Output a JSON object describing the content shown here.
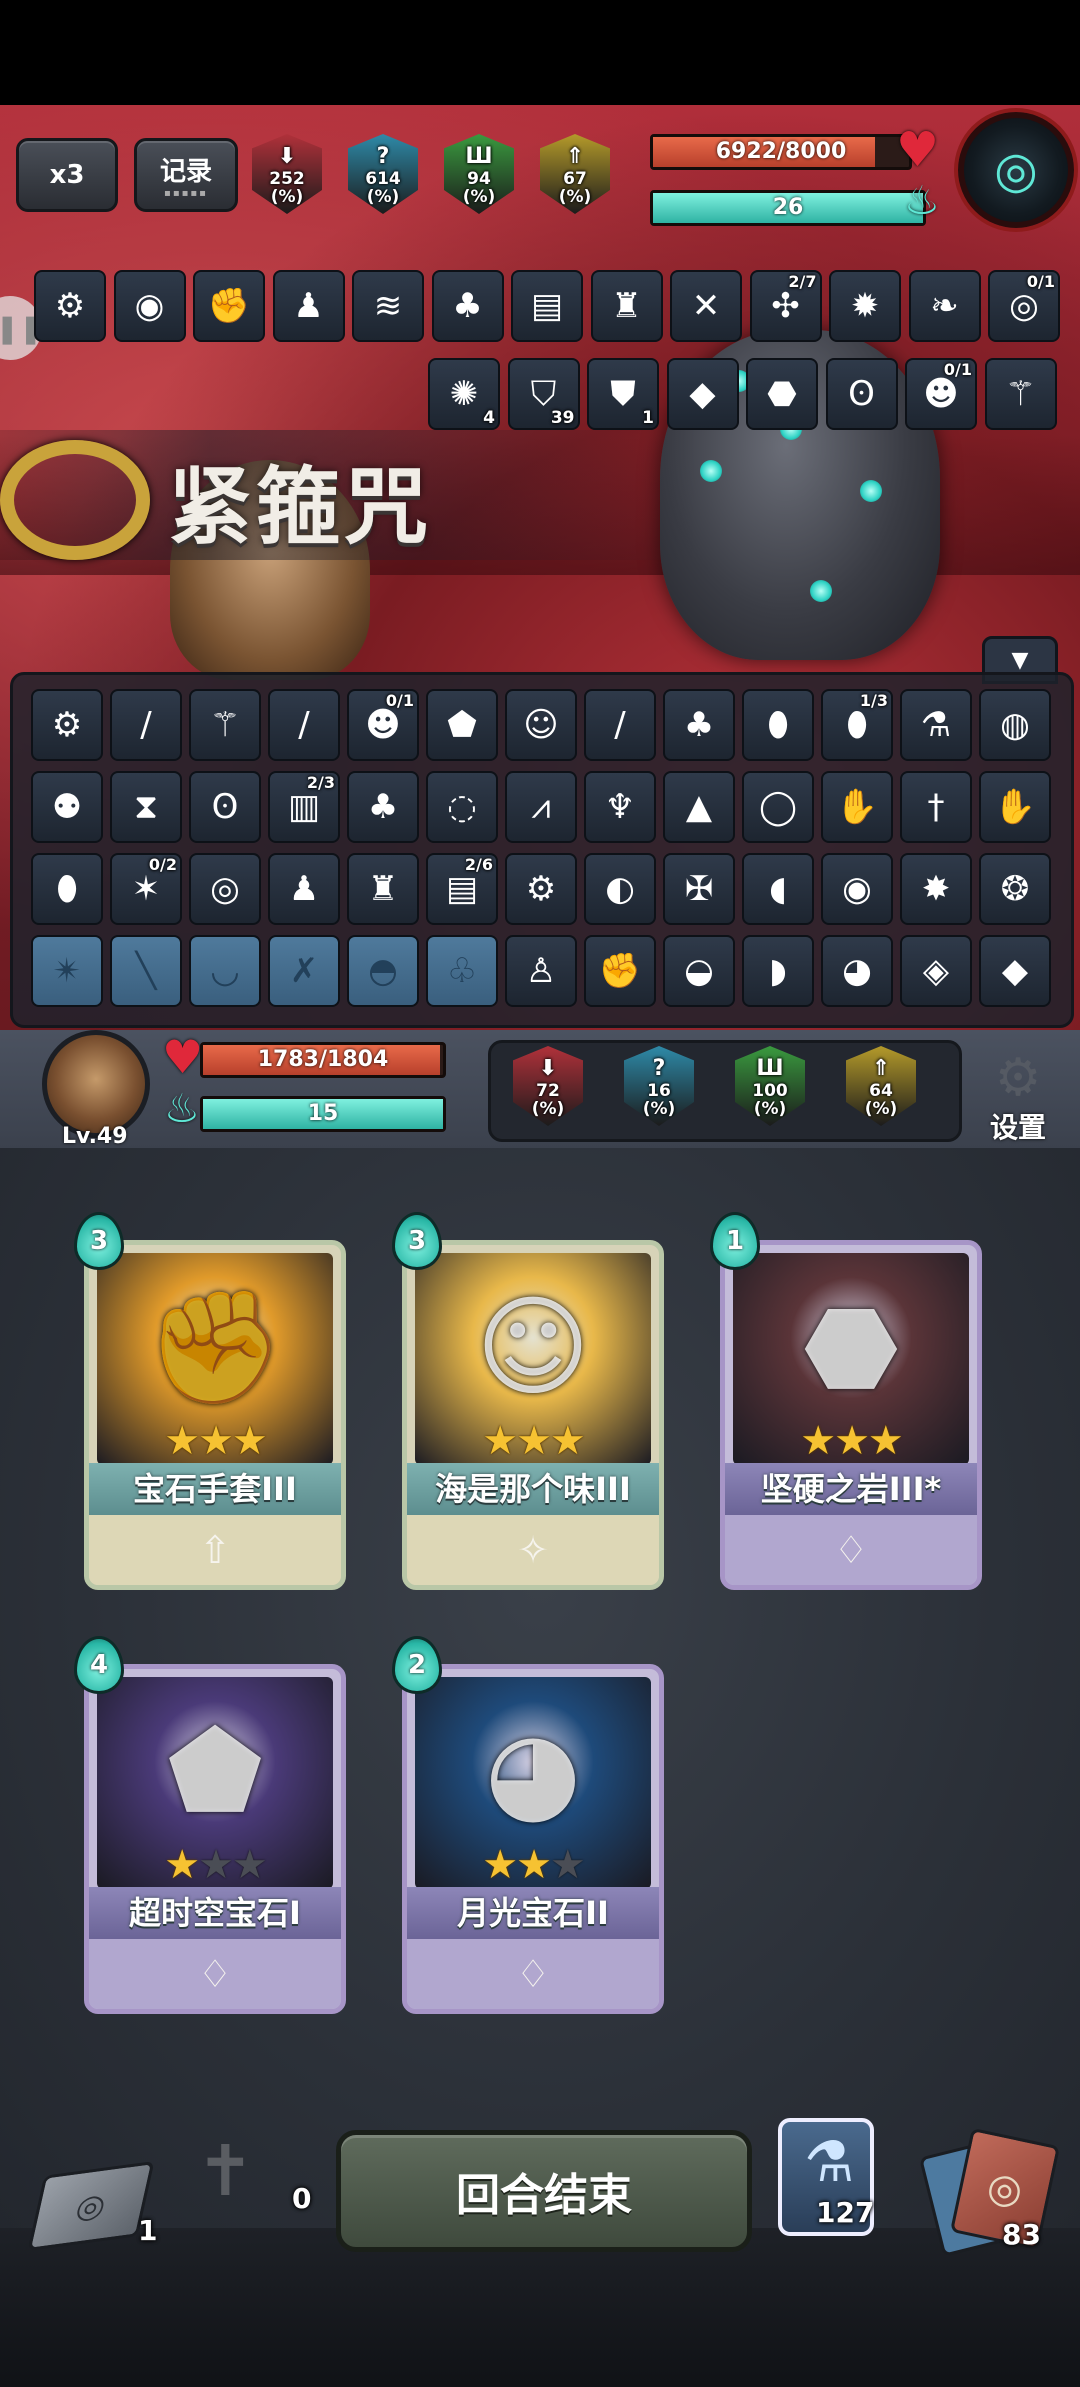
{
  "top_hud": {
    "speed_label": "x3",
    "record_label": "记录",
    "enemy_stats": [
      {
        "value": "252",
        "unit": "(%)",
        "color": "#b0313a",
        "symbol": "⬇"
      },
      {
        "value": "614",
        "unit": "(%)",
        "color": "#2e8aa8",
        "symbol": "?"
      },
      {
        "value": "94",
        "unit": "(%)",
        "color": "#3a9a3f",
        "symbol": "Ш"
      },
      {
        "value": "67",
        "unit": "(%)",
        "color": "#b49a2a",
        "symbol": "⇑"
      }
    ],
    "enemy_hp": {
      "text": "6922/8000",
      "current": 6922,
      "max": 8000
    },
    "enemy_energy": {
      "text": "26"
    }
  },
  "enemy_status_row1": [
    {
      "icon": "claw-gear-icon",
      "glyph": "⚙"
    },
    {
      "icon": "shield-disc-icon",
      "glyph": "◉"
    },
    {
      "icon": "gauntlet-icon",
      "glyph": "✊"
    },
    {
      "icon": "doll-icon",
      "glyph": "♟"
    },
    {
      "icon": "scroll-bundle-icon",
      "glyph": "≋"
    },
    {
      "icon": "ice-cream-icon",
      "glyph": "♣"
    },
    {
      "icon": "book-icon",
      "glyph": "▤"
    },
    {
      "icon": "red-creature-icon",
      "glyph": "♜"
    },
    {
      "icon": "crossbow-icon",
      "glyph": "✕"
    },
    {
      "icon": "compass-icon",
      "glyph": "✣",
      "frac": "2/7"
    },
    {
      "icon": "spiked-helm-icon",
      "glyph": "✹"
    },
    {
      "icon": "feather-icon",
      "glyph": "❧"
    },
    {
      "icon": "paw-ring-icon",
      "glyph": "◎",
      "frac": "0/1"
    }
  ],
  "enemy_status_row2": [
    {
      "icon": "spirit-icon",
      "glyph": "✺",
      "count": "4"
    },
    {
      "icon": "blue-shield-icon",
      "glyph": "⛉",
      "count": "39"
    },
    {
      "icon": "armor-shield-icon",
      "glyph": "⛊",
      "count": "1"
    },
    {
      "icon": "purple-crystal-icon",
      "glyph": "◆"
    },
    {
      "icon": "red-rock-icon",
      "glyph": "⬣"
    },
    {
      "icon": "owl-icon",
      "glyph": "ʘ"
    },
    {
      "icon": "monkey-icon",
      "glyph": "☻",
      "frac": "0/1"
    },
    {
      "icon": "bone-icon",
      "glyph": "⚚"
    }
  ],
  "relic_banner": {
    "name": "紧箍咒"
  },
  "inventory": [
    [
      {
        "icon": "gear-claw-icon",
        "glyph": "⚙"
      },
      {
        "icon": "golden-staff-icon",
        "glyph": "/"
      },
      {
        "icon": "bone-icon",
        "glyph": "⚚"
      },
      {
        "icon": "blue-staff-icon",
        "glyph": "/"
      },
      {
        "icon": "monkey-icon",
        "glyph": "☻",
        "frac": "0/1"
      },
      {
        "icon": "green-gem-icon",
        "glyph": "⬟"
      },
      {
        "icon": "green-face-icon",
        "glyph": "☺"
      },
      {
        "icon": "red-staff-icon",
        "glyph": "/"
      },
      {
        "icon": "green-flask-icon",
        "glyph": "♣"
      },
      {
        "icon": "egg-icon",
        "glyph": "⬮"
      },
      {
        "icon": "red-egg-icon",
        "glyph": "⬮",
        "frac": "1/3"
      },
      {
        "icon": "potion-icon",
        "glyph": "⚗"
      },
      {
        "icon": "crystal-ball-icon",
        "glyph": "◍"
      }
    ],
    [
      {
        "icon": "robot-icon",
        "glyph": "⚉"
      },
      {
        "icon": "hourglass-icon",
        "glyph": "⧗"
      },
      {
        "icon": "owl-icon",
        "glyph": "ʘ"
      },
      {
        "icon": "spellbook-icon",
        "glyph": "▥",
        "frac": "2/3"
      },
      {
        "icon": "ice-cream-icon",
        "glyph": "♣"
      },
      {
        "icon": "wave-orb-icon",
        "glyph": "◌"
      },
      {
        "icon": "spike-trap-icon",
        "glyph": "⩘"
      },
      {
        "icon": "mask-icon",
        "glyph": "♆"
      },
      {
        "icon": "hat-icon",
        "glyph": "▲"
      },
      {
        "icon": "ring-icon",
        "glyph": "◯"
      },
      {
        "icon": "blue-glove-icon",
        "glyph": "✋"
      },
      {
        "icon": "dagger-icon",
        "glyph": "†"
      },
      {
        "icon": "red-glove-icon",
        "glyph": "✋"
      }
    ],
    [
      {
        "icon": "green-egg-icon",
        "glyph": "⬮"
      },
      {
        "icon": "claw-icon",
        "glyph": "✶",
        "frac": "0/2"
      },
      {
        "icon": "spiral-shell-icon",
        "glyph": "◎"
      },
      {
        "icon": "doll-icon",
        "glyph": "♟"
      },
      {
        "icon": "red-creature-icon",
        "glyph": "♜"
      },
      {
        "icon": "red-book-icon",
        "glyph": "▤",
        "frac": "2/6"
      },
      {
        "icon": "claw-gear-icon",
        "glyph": "⚙"
      },
      {
        "icon": "portal-icon",
        "glyph": "◐"
      },
      {
        "icon": "grabber-icon",
        "glyph": "✠"
      },
      {
        "icon": "sock-icon",
        "glyph": "◖"
      },
      {
        "icon": "shield-disc-icon",
        "glyph": "◉"
      },
      {
        "icon": "fire-claw-icon",
        "glyph": "✸"
      },
      {
        "icon": "green-shell-icon",
        "glyph": "❂"
      }
    ],
    [
      {
        "icon": "claw-slot-icon",
        "glyph": "✴",
        "locked": true
      },
      {
        "icon": "staff-slot-icon",
        "glyph": "╲",
        "locked": true
      },
      {
        "icon": "bowl-slot-icon",
        "glyph": "◡",
        "locked": true
      },
      {
        "icon": "guns-slot-icon",
        "glyph": "✗",
        "locked": true
      },
      {
        "icon": "helmet-slot-icon",
        "glyph": "◓",
        "locked": true
      },
      {
        "icon": "tree-slot-icon",
        "glyph": "♧",
        "locked": true
      },
      {
        "icon": "figurine-icon",
        "glyph": "♙"
      },
      {
        "icon": "gauntlet-icon",
        "glyph": "✊"
      },
      {
        "icon": "meat-icon",
        "glyph": "◒"
      },
      {
        "icon": "leg-icon",
        "glyph": "◗"
      },
      {
        "icon": "grenade-icon",
        "glyph": "◕"
      },
      {
        "icon": "target-card-icon",
        "glyph": "◈"
      },
      {
        "icon": "crystal-cluster-icon",
        "glyph": "◆"
      }
    ]
  ],
  "player": {
    "level": "Lv.49",
    "hp": {
      "text": "1783/1804",
      "current": 1783,
      "max": 1804
    },
    "energy": {
      "text": "15"
    },
    "stats": [
      {
        "value": "72",
        "unit": "(%)",
        "color": "#b0313a",
        "symbol": "⬇"
      },
      {
        "value": "16",
        "unit": "(%)",
        "color": "#2e8aa8",
        "symbol": "?"
      },
      {
        "value": "100",
        "unit": "(%)",
        "color": "#3a9a3f",
        "symbol": "Ш"
      },
      {
        "value": "64",
        "unit": "(%)",
        "color": "#b49a2a",
        "symbol": "⇑"
      }
    ],
    "settings_label": "设置"
  },
  "hand": [
    {
      "name": "宝石手套III",
      "cost": "3",
      "stars": 3,
      "kind": "attack",
      "type_glyph": "⇧",
      "art_color": "#e09a2a",
      "art_glyph": "✊"
    },
    {
      "name": "海是那个味III",
      "cost": "3",
      "stars": 3,
      "kind": "skill",
      "type_glyph": "✧",
      "art_color": "#e8b84a",
      "art_glyph": "☺"
    },
    {
      "name": "坚硬之岩III*",
      "cost": "1",
      "stars": 3,
      "kind": "gem",
      "type_glyph": "♢",
      "art_color": "#5a3438",
      "art_glyph": "⬣"
    },
    {
      "name": "超时空宝石I",
      "cost": "4",
      "stars": 1,
      "kind": "gem",
      "type_glyph": "♢",
      "art_color": "#4a3a78",
      "art_glyph": "⬟"
    },
    {
      "name": "月光宝石II",
      "cost": "2",
      "stars": 2,
      "kind": "gem",
      "type_glyph": "♢",
      "art_color": "#1e4a7a",
      "art_glyph": "◕"
    }
  ],
  "bottom_bar": {
    "draw_pile": "1",
    "grave_pile": "0",
    "end_turn_label": "回合结束",
    "potion_count": "127",
    "deck_count": "83"
  },
  "colors": {
    "hp_red": "#d9534a",
    "energy_teal": "#48d6c6",
    "card_attack_border": "#b9c7a7",
    "card_gem_border": "#a795c7",
    "star_gold": "#f6c232"
  }
}
